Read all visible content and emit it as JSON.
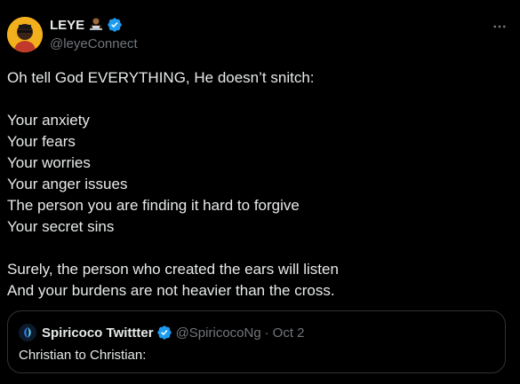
{
  "author": {
    "display_name": "LEYE",
    "emoji": "man-technologist-emoji",
    "handle": "@leyeConnect",
    "verified": true
  },
  "tweet": {
    "intro": "Oh tell God EVERYTHING, He doesn’t snitch:",
    "list": [
      "Your anxiety",
      "Your fears",
      "Your worries",
      "Your anger issues",
      "The person you are finding it hard to forgive",
      "Your secret sins"
    ],
    "closing": [
      "Surely, the person who created the ears will listen",
      "And your burdens are not heavier than the cross."
    ]
  },
  "quote": {
    "display_name": "Spiricoco Twittter",
    "handle": "@SpiricocoNg",
    "separator": "·",
    "date": "Oct 2",
    "text": "Christian to Christian:"
  },
  "colors": {
    "background": "#000000",
    "text": "#e7e9ea",
    "muted": "#71767b",
    "verified": "#1d9bf0",
    "border": "#2f3336"
  }
}
